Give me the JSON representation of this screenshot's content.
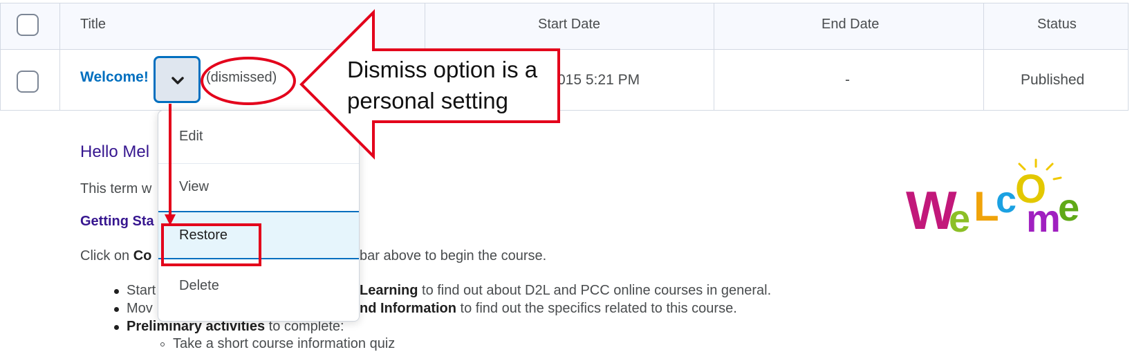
{
  "table": {
    "headers": {
      "title": "Title",
      "start_date": "Start Date",
      "end_date": "End Date",
      "status": "Status"
    },
    "row": {
      "title": "Welcome!",
      "dismissed": "(dismissed)",
      "start_date_visible": "015 5:21 PM",
      "end_date": "-",
      "status": "Published"
    }
  },
  "context_menu": {
    "items": [
      "Edit",
      "View",
      "Restore",
      "Delete"
    ],
    "selected": "Restore"
  },
  "callout": {
    "line1": "Dismiss option is a",
    "line2": "personal setting"
  },
  "content": {
    "greeting": "Hello Mel",
    "intro": "This term w",
    "getting_started": "Getting Sta",
    "click_on": "Click on ",
    "click_on_bold": "Co",
    "click_rest": "bar above to begin the course.",
    "bullet1_a": "Start",
    "bullet1_bold": "Learning",
    "bullet1_rest": " to find out about D2L and PCC online courses in general.",
    "bullet2_a": "Mov",
    "bullet2_bold": "nd Information",
    "bullet2_rest": " to find out the specifics related to this course.",
    "bullet3_bold": "Preliminary activities",
    "bullet3_rest": " to complete:",
    "sub_bullet1": "Take a short course information quiz"
  },
  "welcome_image_text": "WELCOME",
  "colors": {
    "accent": "#006fbf",
    "annotation": "#e3001b",
    "heading": "#36168f"
  }
}
